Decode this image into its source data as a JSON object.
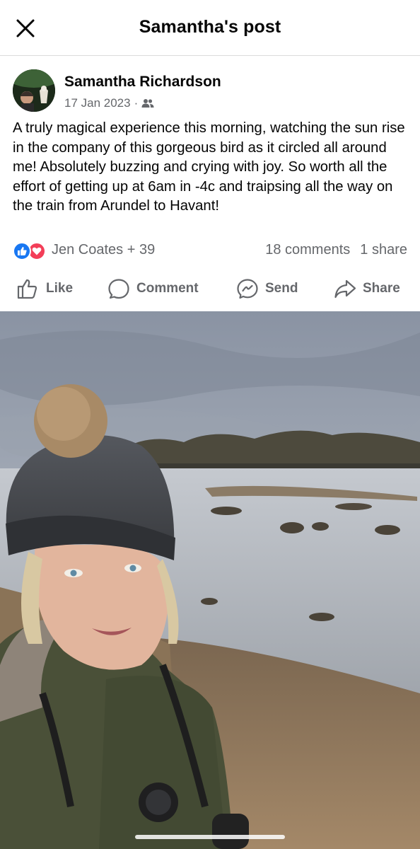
{
  "topbar": {
    "title": "Samantha's post",
    "close_icon": "close-icon"
  },
  "post": {
    "author": "Samantha Richardson",
    "date": "17 Jan 2023",
    "separator": "·",
    "audience_icon": "friends-icon",
    "text": "A truly magical experience this morning, watching the sun rise in the company of this gorgeous bird as it circled all around me! Absolutely buzzing and crying with joy. So worth all the effort of getting up at 6am in -4c and traipsing all the way on the train from Arundel to Havant!"
  },
  "stats": {
    "reaction_icons": [
      "like-reaction-icon",
      "love-reaction-icon"
    ],
    "reactions_text": "Jen Coates + 39",
    "comments": "18 comments",
    "shares": "1 share"
  },
  "actions": {
    "like": "Like",
    "comment": "Comment",
    "send": "Send",
    "share": "Share"
  },
  "colors": {
    "like_blue": "#1877f2",
    "love_red": "#f33e58",
    "secondary_text": "#65676b",
    "divider": "#dcdcdc"
  }
}
